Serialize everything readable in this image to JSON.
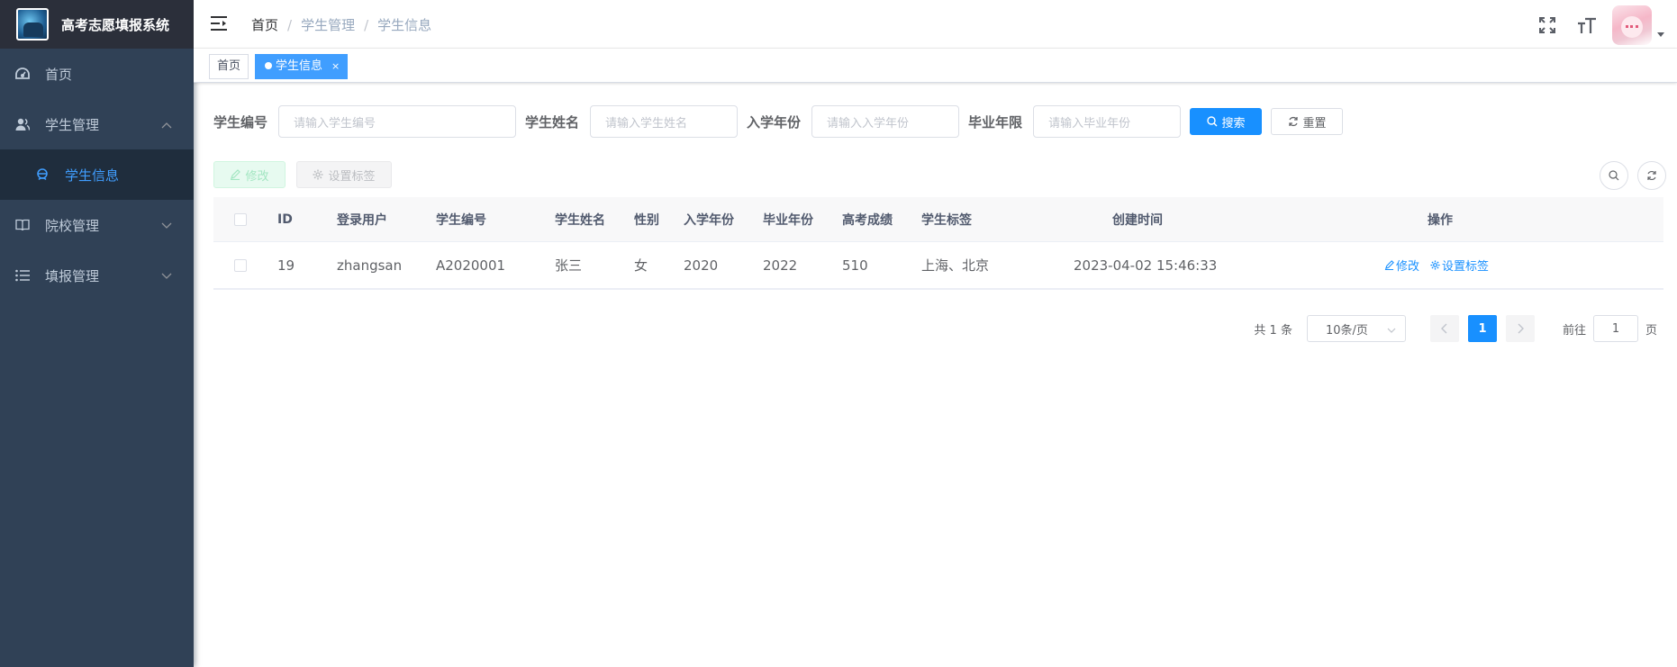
{
  "app": {
    "title": "高考志愿填报系统"
  },
  "sidebar": {
    "items": [
      {
        "label": "首页",
        "icon": "dashboard-icon"
      },
      {
        "label": "学生管理",
        "icon": "user-icon",
        "expanded": true,
        "children": [
          {
            "label": "学生信息",
            "icon": "peoples-icon",
            "active": true
          }
        ]
      },
      {
        "label": "院校管理",
        "icon": "book-icon"
      },
      {
        "label": "填报管理",
        "icon": "list-icon"
      }
    ]
  },
  "navbar": {
    "breadcrumb": [
      "首页",
      "学生管理",
      "学生信息"
    ]
  },
  "tags": [
    {
      "label": "首页",
      "active": false
    },
    {
      "label": "学生信息",
      "active": true,
      "close": "×"
    }
  ],
  "search": {
    "fields": [
      {
        "label": "学生编号",
        "placeholder": "请输入学生编号"
      },
      {
        "label": "学生姓名",
        "placeholder": "请输入学生姓名"
      },
      {
        "label": "入学年份",
        "placeholder": "请输入入学年份"
      },
      {
        "label": "毕业年限",
        "placeholder": "请输入毕业年份"
      }
    ],
    "search_label": "搜索",
    "reset_label": "重置"
  },
  "toolbar": {
    "edit_label": "修改",
    "set_tags_label": "设置标签"
  },
  "table": {
    "columns": [
      "ID",
      "登录用户",
      "学生编号",
      "学生姓名",
      "性别",
      "入学年份",
      "毕业年份",
      "高考成绩",
      "学生标签",
      "创建时间",
      "操作"
    ],
    "rows": [
      {
        "id": "19",
        "user": "zhangsan",
        "code": "A2020001",
        "name": "张三",
        "gender": "女",
        "enroll": "2020",
        "graduate": "2022",
        "score": "510",
        "tags": "上海、北京",
        "created": "2023-04-02 15:46:33",
        "actions": {
          "edit": "修改",
          "set_tags": "设置标签"
        }
      }
    ]
  },
  "pagination": {
    "total": "共 1 条",
    "page_size": "10条/页",
    "current_page": "1",
    "goto_prefix": "前往",
    "goto_value": "1",
    "goto_suffix": "页"
  },
  "colors": {
    "primary": "#1890ff",
    "sidebar_bg": "#304156",
    "sidebar_text": "#bfcbd9",
    "active_menu": "#409eff"
  }
}
